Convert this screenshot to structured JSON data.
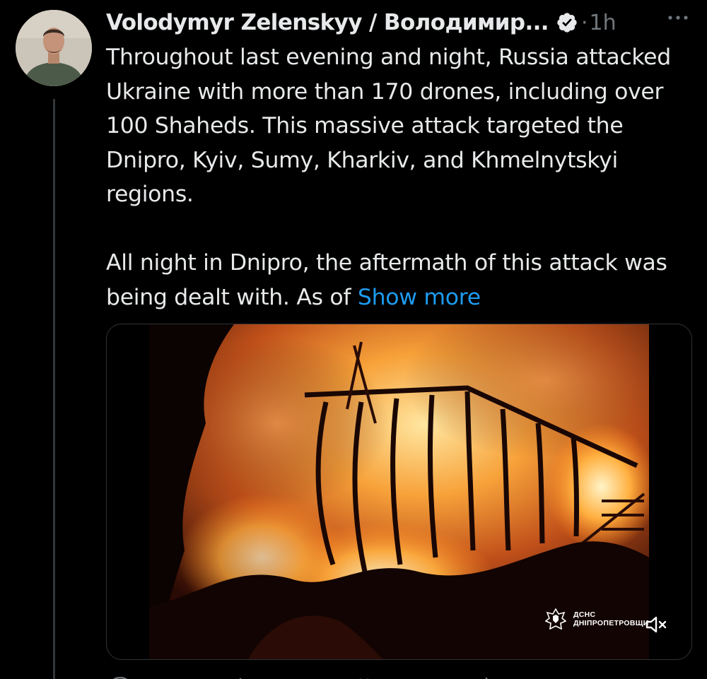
{
  "author": {
    "display_name": "Volodymyr Zelenskyy / Володимир...",
    "verified": true,
    "avatar_icon": "person-portrait"
  },
  "tweet": {
    "separator": "·",
    "time": "1h",
    "paragraph_1": "Throughout last evening and night, Russia attacked Ukraine with more than 170 drones, including over 100 Shaheds. This massive attack targeted the Dnipro, Kyiv, Sumy, Kharkiv, and Khmelnytskyi regions.",
    "paragraph_2": "All night in Dnipro, the aftermath of this attack was being dealt with. As of ",
    "show_more": "Show more"
  },
  "media": {
    "watermark_line_1": "ДСНС",
    "watermark_line_2": "ДНІПРОПЕТРОВЩИНИ",
    "watermark_icon": "dsns-emblem-icon",
    "mute_icon": "volume-muted-icon"
  },
  "colors": {
    "background": "#000000",
    "text": "#e7e9ea",
    "secondary": "#71767b",
    "link": "#1d9bf0",
    "verified": "#e7e9ea"
  }
}
